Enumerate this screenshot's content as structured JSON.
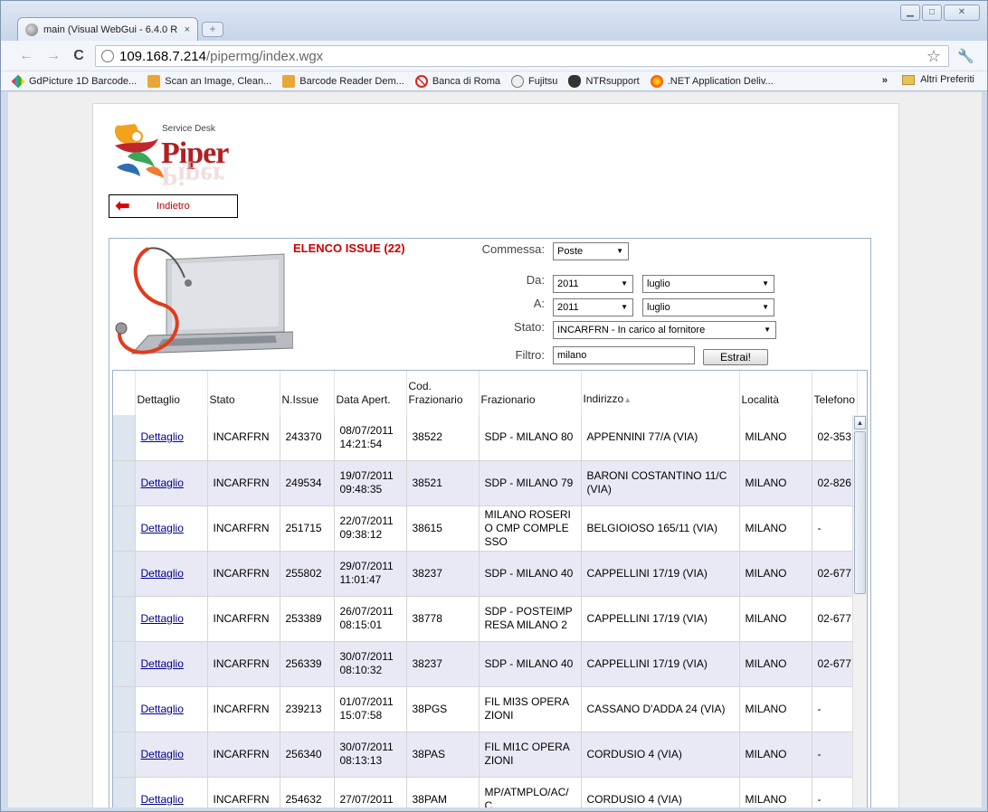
{
  "browser": {
    "tab_title": "main (Visual WebGui - 6.4.0 R",
    "tab_close": "×",
    "new_tab": "+",
    "url_host": "109.168.7.214",
    "url_path": "/pipermg/index.wgx",
    "bookmarks": [
      {
        "label": "GdPicture 1D Barcode...",
        "icon": "diamond"
      },
      {
        "label": "Scan an Image, Clean...",
        "icon": "face"
      },
      {
        "label": "Barcode Reader Dem...",
        "icon": "face"
      },
      {
        "label": "Banca di Roma",
        "icon": "nosign"
      },
      {
        "label": "Fujitsu",
        "icon": "globeg"
      },
      {
        "label": "NTRsupport",
        "icon": "mask"
      },
      {
        "label": ".NET Application Deliv...",
        "icon": "orange"
      }
    ],
    "bookmarks_more": "»",
    "other_bookmarks": "Altri Preferiti"
  },
  "logo": {
    "service_desk": "Service Desk",
    "brand": "Piper"
  },
  "back_button": {
    "label": "Indietro"
  },
  "panel": {
    "title": "ELENCO ISSUE (22)"
  },
  "filters": {
    "commessa_label": "Commessa:",
    "commessa_value": "Poste",
    "da_label": "Da:",
    "da_year": "2011",
    "da_month": "luglio",
    "a_label": "A:",
    "a_year": "2011",
    "a_month": "luglio",
    "stato_label": "Stato:",
    "stato_value": "INCARFRN - In carico al fornitore",
    "filtro_label": "Filtro:",
    "filtro_value": "milano",
    "estrai_label": "Estrai!"
  },
  "table": {
    "headers": {
      "dettaglio": "Dettaglio",
      "stato": "Stato",
      "n_issue": "N.Issue",
      "data_apert": "Data Apert.",
      "cod_fraz": "Cod. Frazionario",
      "frazionario": "Frazionario",
      "indirizzo": "Indirizzo",
      "localita": "Località",
      "telefono": "Telefono"
    },
    "rows": [
      {
        "link": "Dettaglio",
        "stato": "INCARFRN",
        "n": "243370",
        "d1": "08/07/2011",
        "d2": "14:21:54",
        "cod": "38522",
        "fraz": "SDP - MILANO 80",
        "ind": "APPENNINI 77/A (VIA)",
        "loc": "MILANO",
        "tel": "02-353"
      },
      {
        "link": "Dettaglio",
        "stato": "INCARFRN",
        "n": "249534",
        "d1": "19/07/2011",
        "d2": "09:48:35",
        "cod": "38521",
        "fraz": "SDP - MILANO 79",
        "ind": "BARONI COSTANTINO 11/C (VIA)",
        "loc": "MILANO",
        "tel": "02-826"
      },
      {
        "link": "Dettaglio",
        "stato": "INCARFRN",
        "n": "251715",
        "d1": "22/07/2011",
        "d2": "09:38:12",
        "cod": "38615",
        "fraz": "MILANO ROSERIO CMP COMPLESSO",
        "ind": "BELGIOIOSO 165/11 (VIA)",
        "loc": "MILANO",
        "tel": "-"
      },
      {
        "link": "Dettaglio",
        "stato": "INCARFRN",
        "n": "255802",
        "d1": "29/07/2011",
        "d2": "11:01:47",
        "cod": "38237",
        "fraz": "SDP - MILANO 40",
        "ind": "CAPPELLINI 17/19 (VIA)",
        "loc": "MILANO",
        "tel": "02-677"
      },
      {
        "link": "Dettaglio",
        "stato": "INCARFRN",
        "n": "253389",
        "d1": "26/07/2011",
        "d2": "08:15:01",
        "cod": "38778",
        "fraz": "SDP - POSTEIMPRESA MILANO 2",
        "ind": "CAPPELLINI 17/19 (VIA)",
        "loc": "MILANO",
        "tel": "02-677"
      },
      {
        "link": "Dettaglio",
        "stato": "INCARFRN",
        "n": "256339",
        "d1": "30/07/2011",
        "d2": "08:10:32",
        "cod": "38237",
        "fraz": "SDP - MILANO 40",
        "ind": "CAPPELLINI 17/19 (VIA)",
        "loc": "MILANO",
        "tel": "02-677"
      },
      {
        "link": "Dettaglio",
        "stato": "INCARFRN",
        "n": "239213",
        "d1": "01/07/2011",
        "d2": "15:07:58",
        "cod": "38PGS",
        "fraz": "FIL MI3S OPERAZIONI",
        "ind": "CASSANO D'ADDA 24 (VIA)",
        "loc": "MILANO",
        "tel": "-"
      },
      {
        "link": "Dettaglio",
        "stato": "INCARFRN",
        "n": "256340",
        "d1": "30/07/2011",
        "d2": "08:13:13",
        "cod": "38PAS",
        "fraz": "FIL MI1C OPERAZIONI",
        "ind": "CORDUSIO 4 (VIA)",
        "loc": "MILANO",
        "tel": "-"
      },
      {
        "link": "Dettaglio",
        "stato": "INCARFRN",
        "n": "254632",
        "d1": "27/07/2011",
        "d2": "",
        "cod": "38PAM",
        "fraz": "MP/ATMPLO/AC/C",
        "ind": "CORDUSIO 4 (VIA)",
        "loc": "MILANO",
        "tel": "-"
      }
    ]
  }
}
